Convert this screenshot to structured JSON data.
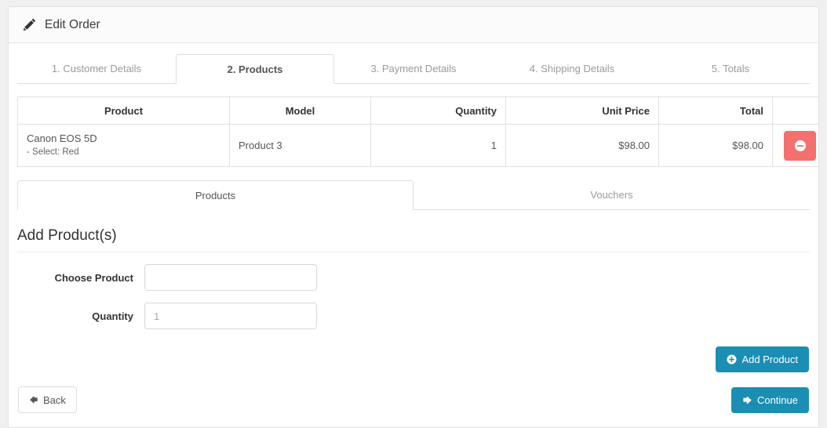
{
  "panel": {
    "title": "Edit Order",
    "title_icon": "pencil-icon"
  },
  "wizard_tabs": [
    {
      "label": "1. Customer Details",
      "active": false
    },
    {
      "label": "2. Products",
      "active": true
    },
    {
      "label": "3. Payment Details",
      "active": false
    },
    {
      "label": "4. Shipping Details",
      "active": false
    },
    {
      "label": "5. Totals",
      "active": false
    }
  ],
  "product_table": {
    "headers": [
      "Product",
      "Model",
      "Quantity",
      "Unit Price",
      "Total",
      ""
    ],
    "rows": [
      {
        "product_name": "Canon EOS 5D",
        "product_option": "- Select: Red",
        "model": "Product 3",
        "quantity": "1",
        "unit_price": "$98.00",
        "total": "$98.00",
        "remove_icon": "minus-circle-icon"
      }
    ]
  },
  "sub_tabs": [
    {
      "label": "Products",
      "active": true
    },
    {
      "label": "Vouchers",
      "active": false
    }
  ],
  "add_products": {
    "section_title": "Add Product(s)",
    "choose_product": {
      "label": "Choose Product",
      "value": "",
      "placeholder": ""
    },
    "quantity": {
      "label": "Quantity",
      "value": "",
      "placeholder": "1"
    },
    "add_button": {
      "label": "Add Product",
      "icon": "plus-circle-icon"
    }
  },
  "footer": {
    "back_button": {
      "label": "Back",
      "icon": "arrow-left-icon"
    },
    "continue_button": {
      "label": "Continue",
      "icon": "arrow-right-icon"
    }
  },
  "colors": {
    "primary": "#1b8eb3",
    "danger": "#f4706e",
    "page_bg": "#f0f0f0",
    "panel_bg": "#ffffff",
    "border": "#dddddd"
  }
}
